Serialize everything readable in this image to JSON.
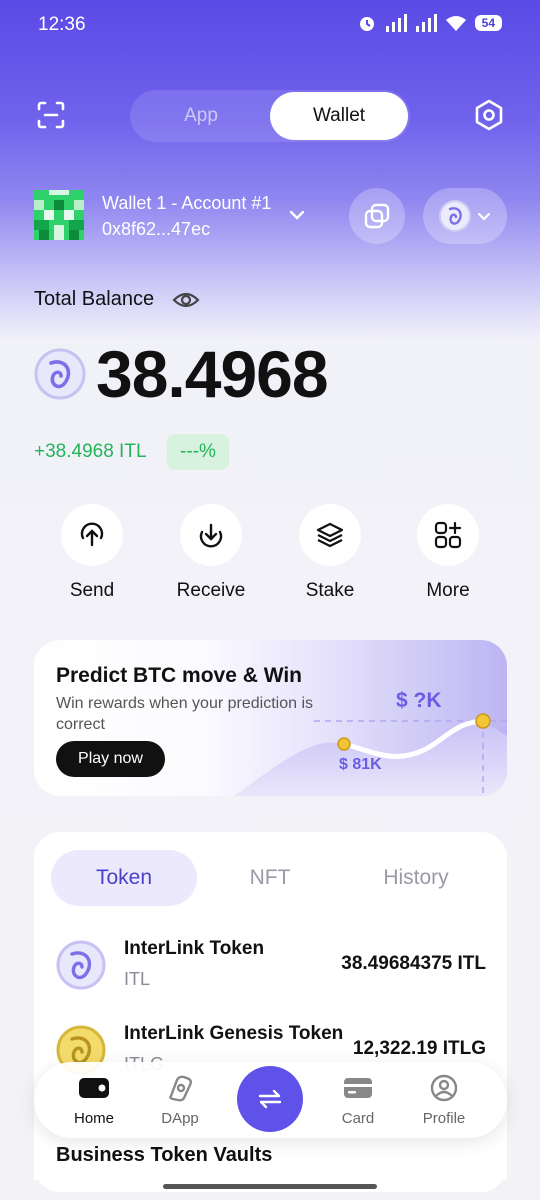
{
  "status_bar": {
    "time": "12:36",
    "battery": "54"
  },
  "top_bar": {
    "segments": [
      {
        "label": "App"
      },
      {
        "label": "Wallet"
      }
    ],
    "active_segment": "Wallet"
  },
  "account": {
    "name": "Wallet 1 - Account #1",
    "address": "0x8f62...47ec"
  },
  "balance": {
    "label": "Total Balance",
    "value": "38.4968",
    "change": "+38.4968 ITL",
    "percent": "---%"
  },
  "actions": [
    {
      "label": "Send",
      "icon": "send-icon"
    },
    {
      "label": "Receive",
      "icon": "receive-icon"
    },
    {
      "label": "Stake",
      "icon": "stake-icon"
    },
    {
      "label": "More",
      "icon": "more-icon"
    }
  ],
  "promo": {
    "title": "Predict BTC move & Win",
    "subtitle": "Win rewards when your prediction is correct",
    "button": "Play now",
    "target_label": "$ ?K",
    "current_label": "$ 81K"
  },
  "token_tabs": [
    {
      "label": "Token"
    },
    {
      "label": "NFT"
    },
    {
      "label": "History"
    }
  ],
  "active_token_tab": "Token",
  "tokens": [
    {
      "name": "InterLink Token",
      "symbol": "ITL",
      "amount": "38.49684375 ITL"
    },
    {
      "name": "InterLink Genesis Token",
      "symbol": "ITLG",
      "amount": "12,322.19 ITLG"
    }
  ],
  "section_title": "Business Token Vaults",
  "bottom_nav": [
    {
      "label": "Home",
      "icon": "wallet-icon"
    },
    {
      "label": "DApp",
      "icon": "compass-icon"
    },
    {
      "label": "Card",
      "icon": "card-icon"
    },
    {
      "label": "Profile",
      "icon": "profile-icon"
    }
  ],
  "colors": {
    "accent": "#5f52e8",
    "positive": "#23b45a",
    "tab_active_bg": "#ebe9fb"
  }
}
